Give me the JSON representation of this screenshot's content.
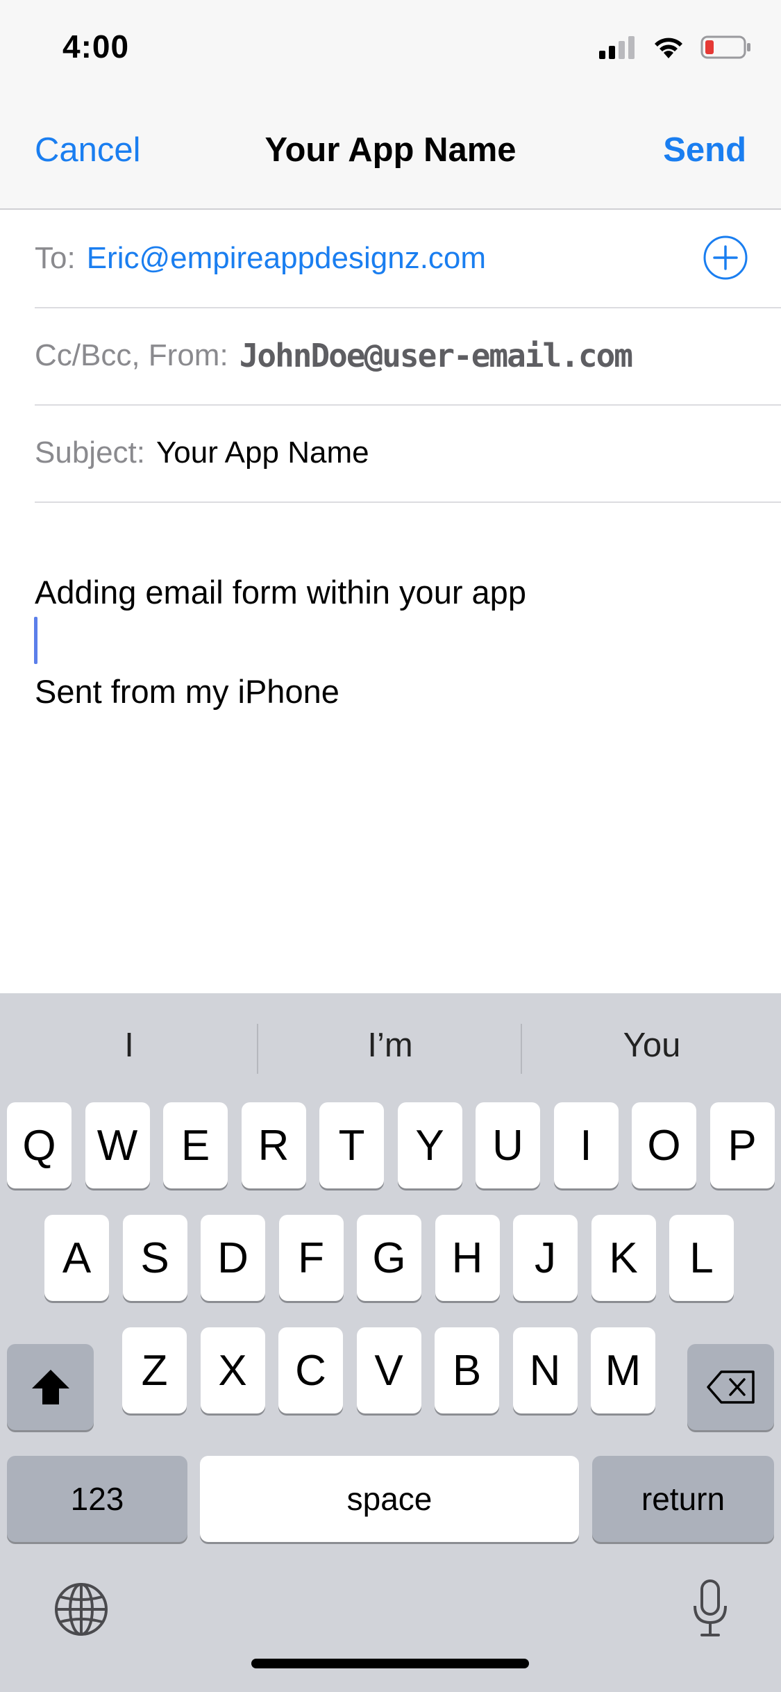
{
  "status_bar": {
    "time": "4:00",
    "icons": [
      "cellular-signal-icon",
      "wifi-icon",
      "battery-low-icon"
    ],
    "battery_color": "#e53935"
  },
  "nav": {
    "cancel_label": "Cancel",
    "title": "Your App Name",
    "send_label": "Send"
  },
  "compose": {
    "to_label": "To:",
    "to_value": "Eric@empireappdesignz.com",
    "cc_from_label": "Cc/Bcc, From:",
    "from_value": "JohnDoe@user-email.com",
    "subject_label": "Subject:",
    "subject_value": "Your App Name",
    "body_text": "Adding email form within your app",
    "signature": "Sent from my iPhone"
  },
  "keyboard": {
    "suggestions": [
      "I",
      "I’m",
      "You"
    ],
    "row1": [
      "Q",
      "W",
      "E",
      "R",
      "T",
      "Y",
      "U",
      "I",
      "O",
      "P"
    ],
    "row2": [
      "A",
      "S",
      "D",
      "F",
      "G",
      "H",
      "J",
      "K",
      "L"
    ],
    "row3": [
      "Z",
      "X",
      "C",
      "V",
      "B",
      "N",
      "M"
    ],
    "numbers_label": "123",
    "space_label": "space",
    "return_label": "return"
  },
  "colors": {
    "accent": "#1a7ef0",
    "keyboard_bg": "#d1d3d9",
    "key_dark": "#acb1bb",
    "cursor": "#5b7fea"
  }
}
